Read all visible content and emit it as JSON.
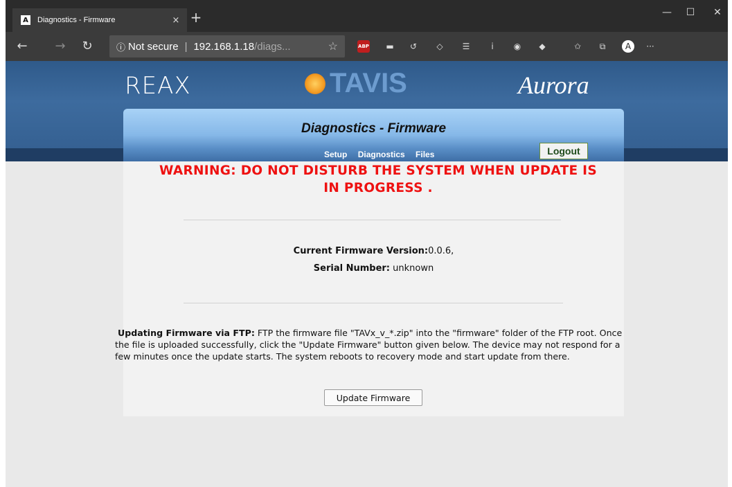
{
  "browser": {
    "tab_title": "Diagnostics - Firmware",
    "tab_close": "×",
    "new_tab": "+",
    "window_controls": {
      "minimize": "—",
      "maximize": "☐",
      "close": "✕"
    },
    "address": {
      "security": "Not secure",
      "host": "192.168.1.18",
      "path": "/diags..."
    },
    "more_menu": "···"
  },
  "branding": {
    "logo_left": "REAX",
    "logo_center": "TAVIS",
    "logo_right": "Aurora"
  },
  "header": {
    "title": "Diagnostics - Firmware",
    "nav": [
      "Setup",
      "Diagnostics",
      "Files"
    ],
    "logout_label": "Logout"
  },
  "main": {
    "warning_line1": "WARNING: DO NOT DISTURB THE SYSTEM WHEN UPDATE IS",
    "warning_line2": "IN PROGRESS .",
    "firmware_label": "Current Firmware Version:",
    "firmware_value": "0.0.6,",
    "serial_label": "Serial Number:",
    "serial_value": " unknown",
    "ftp_heading": "Updating Firmware via FTP:",
    "ftp_body": " FTP the firmware file \"TAVx_v_*.zip\" into the \"firmware\" folder of the FTP root. Once the file is uploaded successfully, click the \"Update Firmware\" button given below. The device may not respond for a few minutes once the update starts. The system reboots to recovery mode and start update from there.",
    "update_button_label": "Update Firmware"
  }
}
